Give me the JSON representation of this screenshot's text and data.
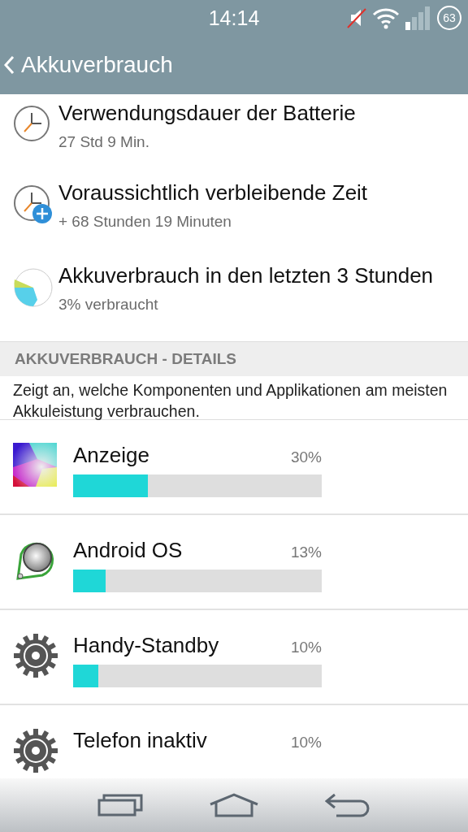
{
  "status_bar": {
    "time": "14:14",
    "battery": "63"
  },
  "action_bar": {
    "title": "Akkuverbrauch"
  },
  "summary": [
    {
      "kind": "clock",
      "title": "Verwendungsdauer der Batterie",
      "subtitle": "27 Std 9 Min."
    },
    {
      "kind": "clock-plus",
      "title": "Voraussichtlich verbleibende Zeit",
      "subtitle": "+ 68 Stunden 19 Minuten"
    },
    {
      "kind": "pie",
      "title": "Akkuverbrauch in den letzten 3 Stunden",
      "subtitle": "3% verbraucht"
    }
  ],
  "section": {
    "header": "AKKUVERBRAUCH - DETAILS",
    "description": "Zeigt an, welche Komponenten und Applikationen am meisten Akkuleistung verbrauchen."
  },
  "apps": [
    {
      "kind": "display",
      "name": "Anzeige",
      "percent": "30%",
      "level": 0.3
    },
    {
      "kind": "android",
      "name": "Android OS",
      "percent": "13%",
      "level": 0.13
    },
    {
      "kind": "gear",
      "name": "Handy-Standby",
      "percent": "10%",
      "level": 0.1
    },
    {
      "kind": "gear",
      "name": "Telefon inaktiv",
      "percent": "10%"
    }
  ]
}
